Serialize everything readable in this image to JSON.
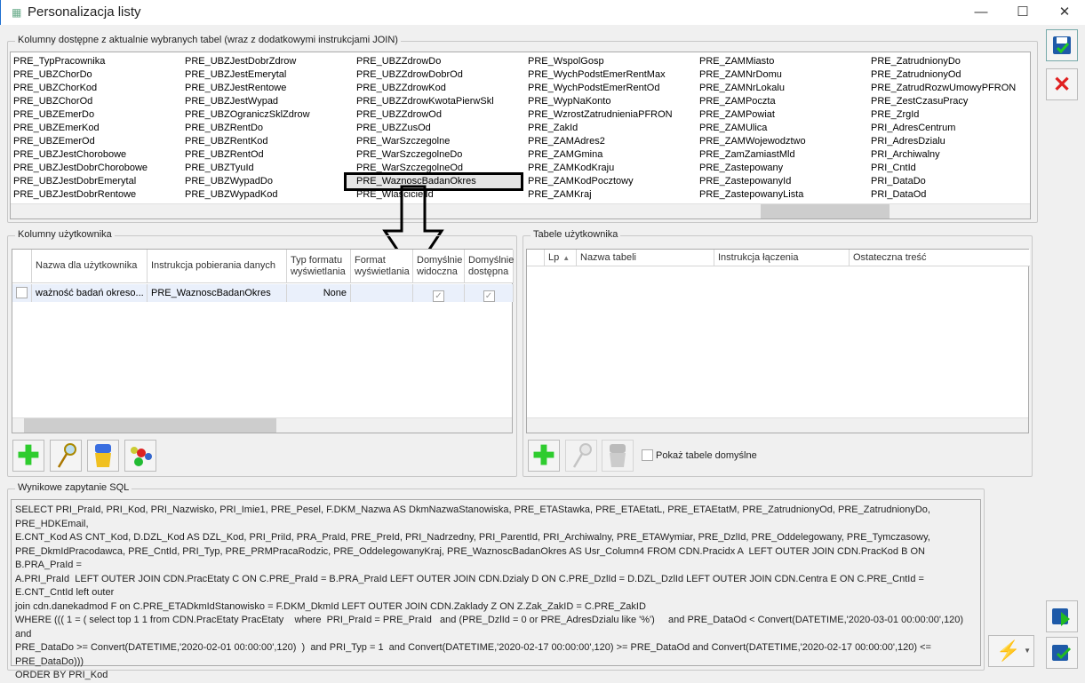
{
  "window": {
    "title": "Personalizacja listy",
    "minimize": "—",
    "maximize": "☐",
    "close": "✕"
  },
  "available": {
    "legend": "Kolumny dostępne z aktualnie wybranych tabel (wraz z dodatkowymi instrukcjami JOIN)",
    "columns": [
      [
        "PRE_TypPracownika",
        "PRE_UBZChorDo",
        "PRE_UBZChorKod",
        "PRE_UBZChorOd",
        "PRE_UBZEmerDo",
        "PRE_UBZEmerKod",
        "PRE_UBZEmerOd",
        "PRE_UBZJestChorobowe",
        "PRE_UBZJestDobrChorobowe",
        "PRE_UBZJestDobrEmerytal",
        "PRE_UBZJestDobrRentowe"
      ],
      [
        "PRE_UBZJestDobrZdrow",
        "PRE_UBZJestEmerytal",
        "PRE_UBZJestRentowe",
        "PRE_UBZJestWypad",
        "PRE_UBZOgraniczSklZdrow",
        "PRE_UBZRentDo",
        "PRE_UBZRentKod",
        "PRE_UBZRentOd",
        "PRE_UBZTyuId",
        "PRE_UBZWypadDo",
        "PRE_UBZWypadKod"
      ],
      [
        "PRE_UBZZdrowDo",
        "PRE_UBZZdrowDobrOd",
        "PRE_UBZZdrowKod",
        "PRE_UBZZdrowKwotaPierwSkl",
        "PRE_UBZZdrowOd",
        "PRE_UBZZusOd",
        "PRE_WarSzczegolne",
        "PRE_WarSzczegolneDo",
        "PRE_WarSzczegolneOd",
        "PRE_WaznoscBadanOkres",
        "PRE_WlascicielId"
      ],
      [
        "PRE_WspolGosp",
        "PRE_WychPodstEmerRentMax",
        "PRE_WychPodstEmerRentOd",
        "PRE_WypNaKonto",
        "PRE_WzrostZatrudnieniaPFRON",
        "PRE_ZakId",
        "PRE_ZAMAdres2",
        "PRE_ZAMGmina",
        "PRE_ZAMKodKraju",
        "PRE_ZAMKodPocztowy",
        "PRE_ZAMKraj"
      ],
      [
        "PRE_ZAMMiasto",
        "PRE_ZAMNrDomu",
        "PRE_ZAMNrLokalu",
        "PRE_ZAMPoczta",
        "PRE_ZAMPowiat",
        "PRE_ZAMUlica",
        "PRE_ZAMWojewodztwo",
        "PRE_ZamZamiastMld",
        "PRE_Zastepowany",
        "PRE_ZastepowanyId",
        "PRE_ZastepowanyLista"
      ],
      [
        "PRE_ZatrudnionyDo",
        "PRE_ZatrudnionyOd",
        "PRE_ZatrudRozwUmowyPFRON",
        "PRE_ZestCzasuPracy",
        "PRE_ZrgId",
        "PRI_AdresCentrum",
        "PRI_AdresDzialu",
        "PRI_Archiwalny",
        "PRI_CntId",
        "PRI_DataDo",
        "PRI_DataOd"
      ]
    ],
    "selected": "PRE_WaznoscBadanOkres"
  },
  "user_columns": {
    "legend": "Kolumny użytkownika",
    "headers": [
      "Nazwa dla użytkownika",
      "Instrukcja pobierania danych",
      "Typ formatu wyświetlania",
      "Format wyświetlania",
      "Domyślnie widoczna",
      "Domyślnie dostępna"
    ],
    "rows": [
      {
        "name": "ważność badań okreso...",
        "instruction": "PRE_WaznoscBadanOkres",
        "format_type": "None",
        "format": "",
        "visible": true,
        "available": true
      }
    ]
  },
  "user_tables": {
    "legend": "Tabele użytkownika",
    "headers": [
      "Lp",
      "Nazwa tabeli",
      "Instrukcja łączenia",
      "Ostateczna treść"
    ],
    "show_default_label": "Pokaż tabele domyślne",
    "show_default": false
  },
  "sql": {
    "legend": "Wynikowe zapytanie SQL",
    "text": "SELECT PRI_PraId, PRI_Kod, PRI_Nazwisko, PRI_Imie1, PRE_Pesel, F.DKM_Nazwa AS DkmNazwaStanowiska, PRE_ETAStawka, PRE_ETAEtatL, PRE_ETAEtatM, PRE_ZatrudnionyOd, PRE_ZatrudnionyDo, PRE_HDKEmail,\nE.CNT_Kod AS CNT_Kod, D.DZL_Kod AS DZL_Kod, PRI_PriId, PRA_PraId, PRE_PreId, PRI_Nadrzedny, PRI_ParentId, PRI_Archiwalny, PRE_ETAWymiar, PRE_DzlId, PRE_Oddelegowany, PRE_Tymczasowy,\nPRE_DkmIdPracodawca, PRE_CntId, PRI_Typ, PRE_PRMPracaRodzic, PRE_OddelegowanyKraj, PRE_WaznoscBadanOkres AS Usr_Column4 FROM CDN.Pracidx A  LEFT OUTER JOIN CDN.PracKod B ON B.PRA_PraId =\nA.PRI_PraId  LEFT OUTER JOIN CDN.PracEtaty C ON C.PRE_PraId = B.PRA_PraId LEFT OUTER JOIN CDN.Dzialy D ON C.PRE_DzlId = D.DZL_DzlId LEFT OUTER JOIN CDN.Centra E ON C.PRE_CntId = E.CNT_CntId left outer\njoin cdn.danekadmod F on C.PRE_ETADkmIdStanowisko = F.DKM_DkmId LEFT OUTER JOIN CDN.Zaklady Z ON Z.Zak_ZakID = C.PRE_ZakID\nWHERE ((( 1 = ( select top 1 1 from CDN.PracEtaty PracEtaty    where  PRI_PraId = PRE_PraId   and (PRE_DzlId = 0 or PRE_AdresDzialu like '%')     and PRE_DataOd < Convert(DATETIME,'2020-03-01 00:00:00',120) and\nPRE_DataDo >= Convert(DATETIME,'2020-02-01 00:00:00',120)  )  and PRI_Typ = 1  and Convert(DATETIME,'2020-02-17 00:00:00',120) >= PRE_DataOd and Convert(DATETIME,'2020-02-17 00:00:00',120) <=\nPRE_DataDo)))\nORDER BY PRI_Kod"
  },
  "colors": {
    "add": "#2ecc2e",
    "cancel": "#e02020",
    "save": "#1e5aa8"
  }
}
